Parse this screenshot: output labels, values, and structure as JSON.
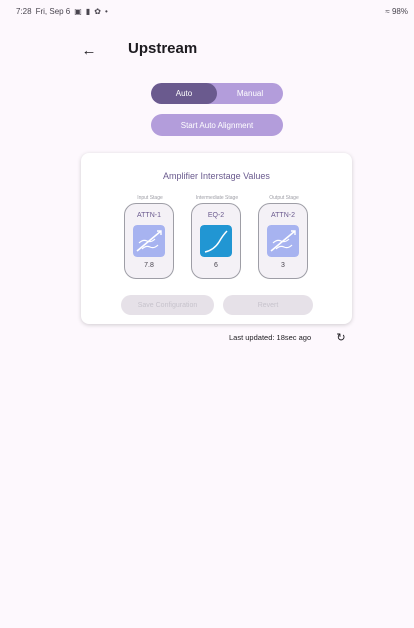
{
  "status_bar": {
    "time": "7:28",
    "date": "Fri, Sep 6",
    "battery": "98%"
  },
  "header": {
    "back_icon": "arrow-left-icon",
    "title": "Upstream"
  },
  "mode_toggle": {
    "options": [
      "Auto",
      "Manual"
    ],
    "selected": "Auto"
  },
  "auto_alignment": {
    "label": "Start Auto Alignment"
  },
  "card": {
    "title": "Amplifier Interstage Values",
    "stages": [
      {
        "stage_label": "Input Stage",
        "name": "ATTN-1",
        "value": "7.8",
        "icon": "attenuator-icon"
      },
      {
        "stage_label": "Intermediate Stage",
        "name": "EQ-2",
        "value": "6",
        "icon": "equalizer-curve-icon"
      },
      {
        "stage_label": "Output Stage",
        "name": "ATTN-2",
        "value": "3",
        "icon": "attenuator-icon"
      }
    ],
    "save_label": "Save Configuration",
    "revert_label": "Revert"
  },
  "footer": {
    "last_updated": "Last updated: 18sec ago",
    "refresh_icon": "refresh-icon"
  },
  "colors": {
    "background": "#fdf8fd",
    "primary": "#6a5a8e",
    "primary_light": "#b39ddb",
    "eq_icon": "#2196d3",
    "attn_icon": "#a7b3f0"
  }
}
